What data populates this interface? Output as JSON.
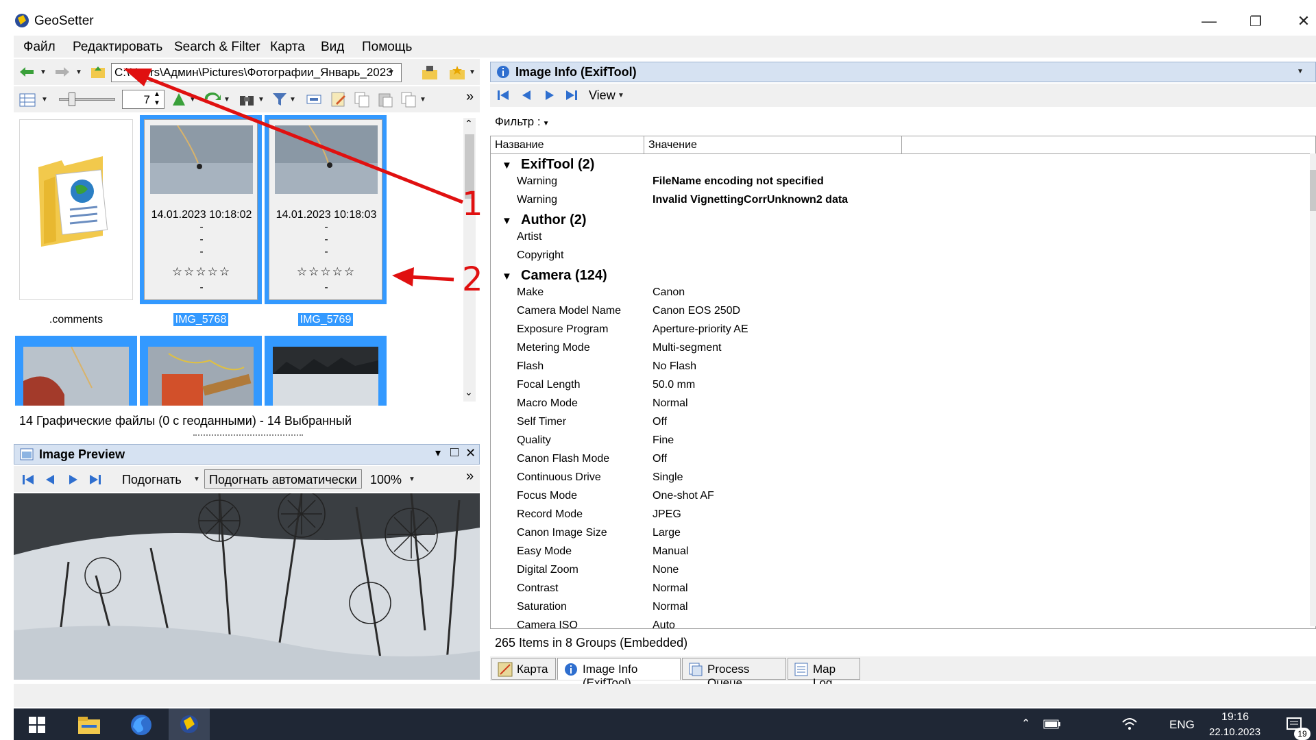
{
  "window": {
    "title": "GeoSetter",
    "minimize": "—",
    "maximize": "❐",
    "close": "✕"
  },
  "menu": [
    "Файл",
    "Редактировать",
    "Search & Filter",
    "Карта",
    "Вид",
    "Помощь"
  ],
  "toolbar": {
    "path": "C:\\Users\\Админ\\Pictures\\Фотографии_Январь_2023",
    "thumb_count": "7",
    "more": "»"
  },
  "thumbnails": [
    {
      "label": ".comments",
      "type": "folder",
      "selected": false
    },
    {
      "label": "IMG_5768",
      "date": "14.01.2023 10:18:02",
      "lines": [
        "-",
        "-",
        "-"
      ],
      "after": "-",
      "stars": "☆☆☆☆☆",
      "selected": true
    },
    {
      "label": "IMG_5769",
      "date": "14.01.2023 10:18:03",
      "lines": [
        "-",
        "-",
        "-"
      ],
      "after": "-",
      "stars": "☆☆☆☆☆",
      "selected": true
    }
  ],
  "file_status": "14 Графические файлы  (0 с геоданными)  - 14 Выбранный",
  "preview": {
    "title": "Image Preview",
    "fit_label": "Подогнать",
    "auto_fit_label": "Подогнать автоматически",
    "zoom": "100%",
    "pin": "▾",
    "float": "□",
    "close": "✕",
    "more": "»"
  },
  "info_panel": {
    "title": "Image Info (ExifTool)",
    "view_label": "View",
    "filter_label": "Фильтр :",
    "columns": [
      "Название",
      "Значение"
    ],
    "groups": [
      {
        "name": "ExifTool (2)",
        "rows": [
          {
            "k": "Warning",
            "v": "FileName encoding not specified",
            "bold": true
          },
          {
            "k": "Warning",
            "v": "Invalid VignettingCorrUnknown2 data",
            "bold": true
          }
        ]
      },
      {
        "name": "Author (2)",
        "rows": [
          {
            "k": "Artist",
            "v": ""
          },
          {
            "k": "Copyright",
            "v": ""
          }
        ]
      },
      {
        "name": "Camera (124)",
        "rows": [
          {
            "k": "Make",
            "v": "Canon"
          },
          {
            "k": "Camera Model Name",
            "v": "Canon EOS 250D"
          },
          {
            "k": "Exposure Program",
            "v": "Aperture-priority AE"
          },
          {
            "k": "Metering Mode",
            "v": "Multi-segment"
          },
          {
            "k": "Flash",
            "v": "No Flash"
          },
          {
            "k": "Focal Length",
            "v": "50.0 mm"
          },
          {
            "k": "Macro Mode",
            "v": "Normal"
          },
          {
            "k": "Self Timer",
            "v": "Off"
          },
          {
            "k": "Quality",
            "v": "Fine"
          },
          {
            "k": "Canon Flash Mode",
            "v": "Off"
          },
          {
            "k": "Continuous Drive",
            "v": "Single"
          },
          {
            "k": "Focus Mode",
            "v": "One-shot AF"
          },
          {
            "k": "Record Mode",
            "v": "JPEG"
          },
          {
            "k": "Canon Image Size",
            "v": "Large"
          },
          {
            "k": "Easy Mode",
            "v": "Manual"
          },
          {
            "k": "Digital Zoom",
            "v": "None"
          },
          {
            "k": "Contrast",
            "v": "Normal"
          },
          {
            "k": "Saturation",
            "v": "Normal"
          },
          {
            "k": "Camera ISO",
            "v": "Auto"
          }
        ]
      }
    ],
    "status": "265 Items in 8 Groups   (Embedded)"
  },
  "tabs": [
    "Карта",
    "Image Info (ExifTool)",
    "Process Queue",
    "Map Log"
  ],
  "taskbar": {
    "lang": "ENG",
    "time": "19:16",
    "date": "22.10.2023",
    "notif_count": "19"
  },
  "annotations": [
    "1",
    "2"
  ],
  "colors": {
    "selection": "#3399ff",
    "annotation": "#e01010",
    "panel_header": "#d6e2f2",
    "taskbar": "#1f2735"
  }
}
